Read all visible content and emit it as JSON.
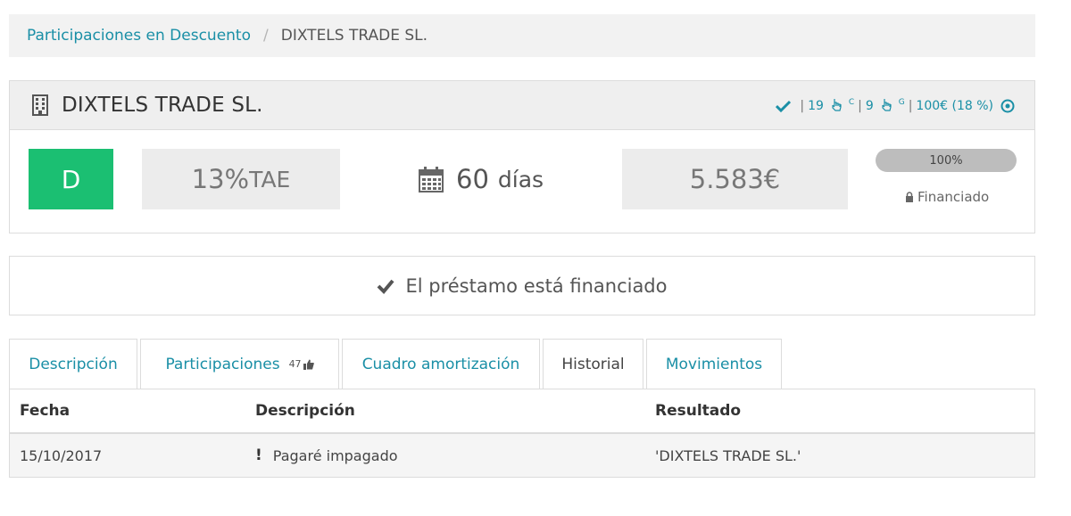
{
  "breadcrumb": {
    "parent": "Participaciones en Descuento",
    "separator": "/",
    "current": "DIXTELS TRADE SL."
  },
  "loan": {
    "company": "DIXTELS TRADE SL.",
    "stats": {
      "count_c": "19",
      "sup_c": "C",
      "count_g": "9",
      "sup_g": "G",
      "investment": "100€ (18 %)"
    },
    "rating": "D",
    "rate_value": "13%",
    "rate_unit": "TAE",
    "days_value": "60",
    "days_unit": "días",
    "amount": "5.583€",
    "progress_label": "100%",
    "progress_fraction": 1.0,
    "status": "Financiado"
  },
  "banner": {
    "text": "El préstamo está financiado"
  },
  "tabs": [
    {
      "label": "Descripción"
    },
    {
      "label": "Participaciones",
      "badge": "47"
    },
    {
      "label": "Cuadro amortización"
    },
    {
      "label": "Historial"
    },
    {
      "label": "Movimientos"
    }
  ],
  "history": {
    "headers": {
      "date": "Fecha",
      "description": "Descripción",
      "result": "Resultado"
    },
    "rows": [
      {
        "date": "15/10/2017",
        "description": "Pagaré impagado",
        "result": "'DIXTELS TRADE SL.'"
      }
    ]
  },
  "colors": {
    "accent": "#1a8fa6",
    "rating_green": "#1bbf72"
  },
  "icons": [
    "building-icon",
    "check-icon",
    "hand-pointer-icon",
    "target-icon",
    "calendar-icon",
    "lock-icon",
    "thumbs-up-icon",
    "exclamation-icon"
  ]
}
